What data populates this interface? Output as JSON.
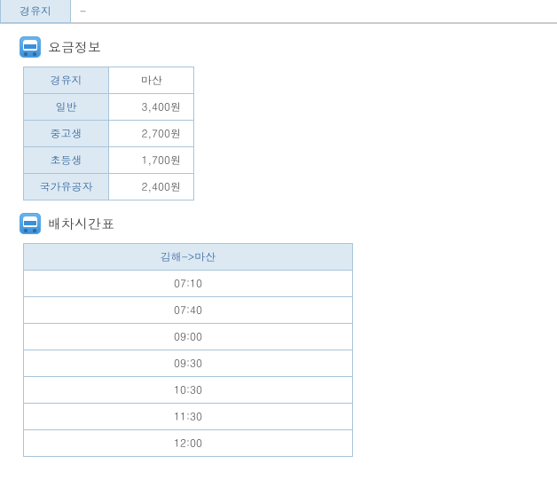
{
  "topRow": {
    "label": "경유지",
    "value": "-"
  },
  "fareSection": {
    "title": "요금정보",
    "rows": [
      {
        "label": "경유지",
        "value": "마산",
        "center": true
      },
      {
        "label": "일반",
        "value": "3,400원"
      },
      {
        "label": "중고생",
        "value": "2,700원"
      },
      {
        "label": "초등생",
        "value": "1,700원"
      },
      {
        "label": "국가유공자",
        "value": "2,400원"
      }
    ]
  },
  "scheduleSection": {
    "title": "배차시간표",
    "header": "김해->마산",
    "times": [
      "07:10",
      "07:40",
      "09:00",
      "09:30",
      "10:30",
      "11:30",
      "12:00"
    ]
  }
}
